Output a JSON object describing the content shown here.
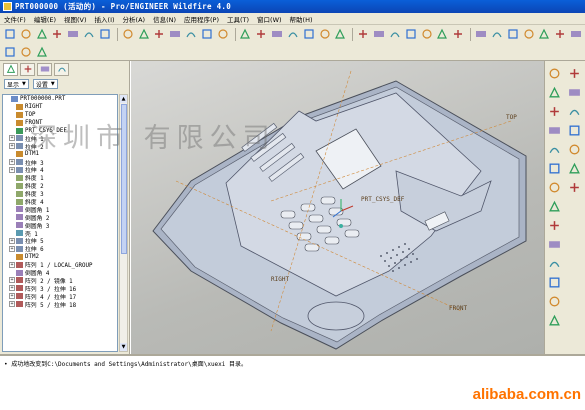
{
  "window": {
    "title": "PRT000000 (活动的) - Pro/ENGINEER Wildfire 4.0"
  },
  "menu": [
    "文件(F)",
    "编辑(E)",
    "视图(V)",
    "插入(I)",
    "分析(A)",
    "信息(N)",
    "应用程序(P)",
    "工具(T)",
    "窗口(W)",
    "帮助(H)"
  ],
  "toolbar1_icons": [
    "new-icon",
    "open-icon",
    "save-icon",
    "print-icon",
    "email-icon",
    "copy-doc-icon",
    "save-as-icon",
    "undo-icon",
    "redo-icon",
    "cut-icon",
    "copy-icon",
    "paste-icon",
    "paste-special-icon",
    "regenerate-icon",
    "reference-icon",
    "find-icon",
    "select-box-icon",
    "select-filter-icon",
    "spin-center-icon",
    "orient-icon",
    "refit-icon",
    "zoom-in-icon",
    "zoom-out-icon",
    "repaint-icon",
    "spin-icon",
    "view-manager-icon",
    "saved-views-icon",
    "wireframe-icon",
    "hidden-line-icon",
    "no-hidden-icon",
    "shading-icon",
    "datum-plane-icon",
    "datum-axis-icon",
    "datum-point-icon",
    "csys-icon"
  ],
  "toolbar2_icons": [
    "sketch-icon",
    "style-icon",
    "context-help-icon"
  ],
  "nav_tabs": [
    "model-tree-tab",
    "folder-tab",
    "favorites-tab",
    "connections-tab"
  ],
  "pane": {
    "show_label": "显示",
    "settings_label": "设置"
  },
  "tree": [
    {
      "label": "PRT000000.PRT",
      "expander": "none",
      "icon": "part-icon"
    },
    {
      "label": "RIGHT",
      "expander": "none",
      "icon": "plane-icon"
    },
    {
      "label": "TOP",
      "expander": "none",
      "icon": "plane-icon"
    },
    {
      "label": "FRONT",
      "expander": "none",
      "icon": "plane-icon"
    },
    {
      "label": "PRT_CSYS_DEF",
      "expander": "none",
      "icon": "csys-icon"
    },
    {
      "label": "拉伸 1",
      "expander": "+",
      "icon": "extrude-icon"
    },
    {
      "label": "拉伸 2",
      "expander": "+",
      "icon": "extrude-icon"
    },
    {
      "label": "DTM1",
      "expander": "none",
      "icon": "plane-icon"
    },
    {
      "label": "拉伸 3",
      "expander": "+",
      "icon": "extrude-icon"
    },
    {
      "label": "拉伸 4",
      "expander": "+",
      "icon": "extrude-icon"
    },
    {
      "label": "斜度 1",
      "expander": "none",
      "icon": "draft-icon"
    },
    {
      "label": "斜度 2",
      "expander": "none",
      "icon": "draft-icon"
    },
    {
      "label": "斜度 3",
      "expander": "none",
      "icon": "draft-icon"
    },
    {
      "label": "斜度 4",
      "expander": "none",
      "icon": "draft-icon"
    },
    {
      "label": "倒圆角 1",
      "expander": "none",
      "icon": "round-icon"
    },
    {
      "label": "倒圆角 2",
      "expander": "none",
      "icon": "round-icon"
    },
    {
      "label": "倒圆角 3",
      "expander": "none",
      "icon": "round-icon"
    },
    {
      "label": "壳 1",
      "expander": "none",
      "icon": "shell-icon"
    },
    {
      "label": "拉伸 5",
      "expander": "+",
      "icon": "extrude-icon"
    },
    {
      "label": "拉伸 6",
      "expander": "+",
      "icon": "extrude-icon"
    },
    {
      "label": "DTM2",
      "expander": "none",
      "icon": "plane-icon"
    },
    {
      "label": "阵列 1 / LOCAL_GROUP",
      "expander": "+",
      "icon": "pattern-icon"
    },
    {
      "label": "倒圆角 4",
      "expander": "none",
      "icon": "round-icon"
    },
    {
      "label": "阵列 2 / 镜像 1",
      "expander": "+",
      "icon": "pattern-icon"
    },
    {
      "label": "阵列 3 / 拉伸 16",
      "expander": "+",
      "icon": "pattern-icon"
    },
    {
      "label": "阵列 4 / 拉伸 17",
      "expander": "+",
      "icon": "pattern-icon"
    },
    {
      "label": "阵列 5 / 拉伸 18",
      "expander": "+",
      "icon": "pattern-icon"
    }
  ],
  "viewport": {
    "datum_labels": {
      "right": "RIGHT",
      "top": "TOP",
      "front": "FRONT",
      "csys": "PRT_CSYS_DEF"
    },
    "watermark": "深圳市    有限公司",
    "background_colors": {
      "light": "#d9d9d6",
      "dark": "#aeb0ac"
    },
    "model_color": "#b9c3d4"
  },
  "right_toolbar_icons": [
    "datum-plane-icon",
    "datum-axis-icon",
    "datum-curve-icon",
    "datum-point-icon",
    "csys-icon",
    "analysis-icon",
    "sketch-tool-icon",
    "extrude-icon",
    "revolve-icon",
    "variable-sweep-icon",
    "blend-icon",
    "hole-icon",
    "shell-icon",
    "rib-icon",
    "draft-icon",
    "round-icon",
    "chamfer-icon",
    "mirror-icon",
    "merge-icon",
    "trim-icon",
    "pattern-icon"
  ],
  "messages": [
    "• 成功地改变到C:\\Documents and Settings\\Administrator\\桌面\\xuexi 目录。"
  ],
  "brand": "alibaba.com.cn"
}
